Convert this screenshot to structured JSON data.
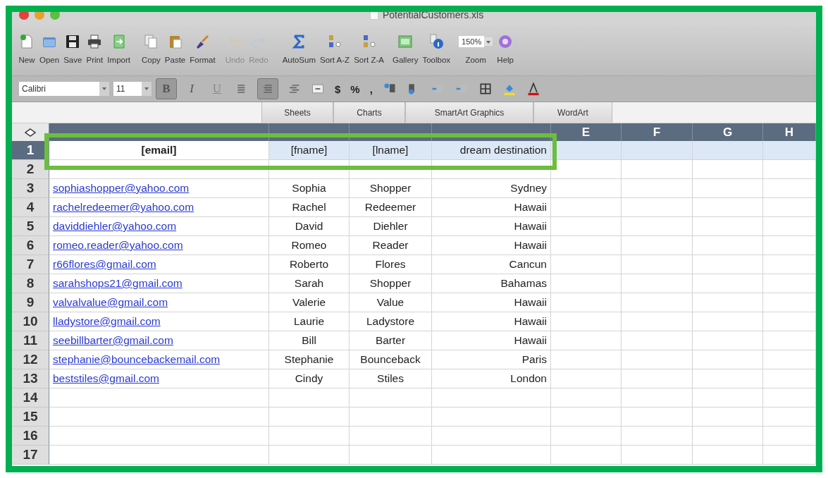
{
  "window": {
    "title": "PotentialCustomers.xls"
  },
  "toolbar": [
    {
      "label": "New",
      "disabled": false
    },
    {
      "label": "Open",
      "disabled": false
    },
    {
      "label": "Save",
      "disabled": false
    },
    {
      "label": "Print",
      "disabled": false
    },
    {
      "label": "Import",
      "disabled": false
    },
    {
      "label": "Copy",
      "disabled": false
    },
    {
      "label": "Paste",
      "disabled": false
    },
    {
      "label": "Format",
      "disabled": false
    },
    {
      "label": "Undo",
      "disabled": true
    },
    {
      "label": "Redo",
      "disabled": true
    },
    {
      "label": "AutoSum",
      "disabled": false
    },
    {
      "label": "Sort A-Z",
      "disabled": false
    },
    {
      "label": "Sort Z-A",
      "disabled": false
    },
    {
      "label": "Gallery",
      "disabled": false
    },
    {
      "label": "Toolbox",
      "disabled": false
    },
    {
      "label": "Zoom",
      "disabled": false,
      "kind": "field",
      "value": "150%"
    },
    {
      "label": "Help",
      "disabled": false
    }
  ],
  "format_bar": [
    {
      "kind": "field",
      "value": "Calibri"
    },
    {
      "kind": "field",
      "value": "11"
    },
    {
      "kind": "toggle",
      "label": "B",
      "on": true
    },
    {
      "kind": "toggle",
      "label": "I",
      "on": false
    },
    {
      "kind": "toggle",
      "label": "U",
      "on": false
    },
    {
      "kind": "toggle",
      "on": false
    },
    {
      "kind": "toggle",
      "on": true
    },
    {
      "kind": "toggle",
      "on": false
    },
    {
      "kind": "icon"
    },
    {
      "kind": "text",
      "label": "$"
    },
    {
      "kind": "text",
      "label": "%"
    },
    {
      "kind": "text",
      "label": ","
    },
    {
      "kind": "icon"
    },
    {
      "kind": "icon"
    },
    {
      "kind": "icon"
    },
    {
      "kind": "icon"
    },
    {
      "kind": "icon"
    },
    {
      "kind": "icon"
    },
    {
      "kind": "icon"
    }
  ],
  "ribbon_tabs": [
    "Sheets",
    "Charts",
    "SmartArt Graphics",
    "WordArt"
  ],
  "sheet": {
    "columns": [
      "E",
      "F",
      "G",
      "H"
    ],
    "rows": [
      {
        "number": "1",
        "selected": true,
        "cells": [
          "[email]",
          "[fname]",
          "[lname]",
          "dream destination"
        ]
      },
      {
        "number": "2",
        "selected": false,
        "cells": []
      },
      {
        "number": "3",
        "selected": false,
        "cells": [
          "sophiashopper@yahoo.com",
          "Sophia",
          "Shopper",
          "Sydney"
        ]
      },
      {
        "number": "4",
        "selected": false,
        "cells": [
          "rachelredeemer@yahoo.com",
          "Rachel",
          "Redeemer",
          "Hawaii"
        ]
      },
      {
        "number": "5",
        "selected": false,
        "cells": [
          "daviddiehler@yahoo.com",
          "David",
          "Diehler",
          "Hawaii"
        ]
      },
      {
        "number": "6",
        "selected": false,
        "cells": [
          "romeo.reader@yahoo.com",
          "Romeo",
          "Reader",
          "Hawaii"
        ]
      },
      {
        "number": "7",
        "selected": false,
        "cells": [
          "r66flores@gmail.com",
          "Roberto",
          "Flores",
          "Cancun"
        ]
      },
      {
        "number": "8",
        "selected": false,
        "cells": [
          "sarahshops21@gmail.com",
          "Sarah",
          "Shopper",
          "Bahamas"
        ]
      },
      {
        "number": "9",
        "selected": false,
        "cells": [
          "valvalvalue@gmail.com",
          "Valerie",
          "Value",
          "Hawaii"
        ]
      },
      {
        "number": "10",
        "selected": false,
        "cells": [
          "lladystore@gmail.com",
          "Laurie",
          "Ladystore",
          "Hawaii"
        ]
      },
      {
        "number": "11",
        "selected": false,
        "cells": [
          "seebillbarter@gmail.com",
          "Bill",
          "Barter",
          "Hawaii"
        ]
      },
      {
        "number": "12",
        "selected": false,
        "cells": [
          "stephanie@bouncebackemail.com",
          "Stephanie",
          "Bounceback",
          "Paris"
        ]
      },
      {
        "number": "13",
        "selected": false,
        "cells": [
          "beststiles@gmail.com",
          "Cindy",
          "Stiles",
          "London"
        ]
      },
      {
        "number": "14",
        "selected": false,
        "cells": []
      },
      {
        "number": "15",
        "selected": false,
        "cells": []
      },
      {
        "number": "16",
        "selected": false,
        "cells": []
      },
      {
        "number": "17",
        "selected": false,
        "cells": []
      }
    ]
  }
}
